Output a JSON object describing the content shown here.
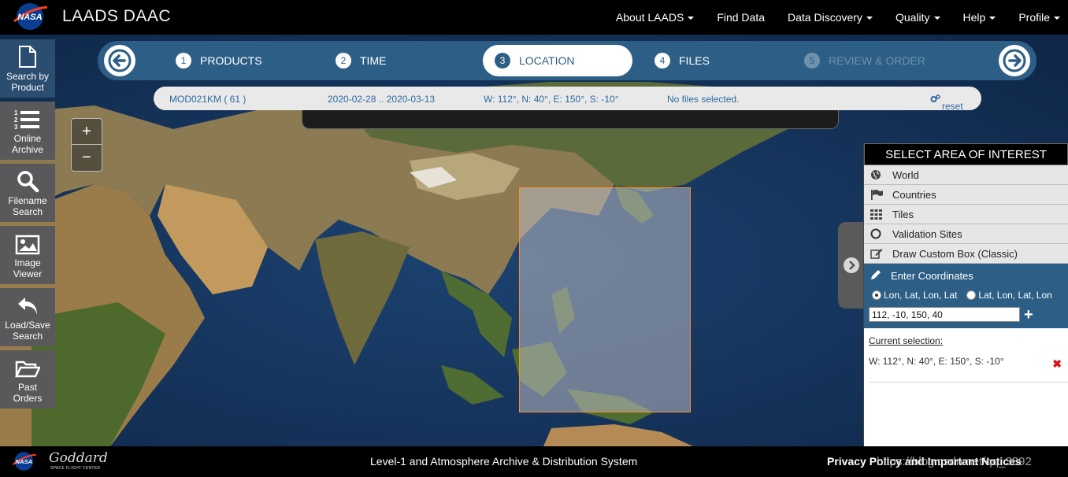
{
  "header": {
    "site_title": "LAADS DAAC",
    "nav": [
      {
        "label": "About LAADS",
        "dropdown": true
      },
      {
        "label": "Find Data",
        "dropdown": false
      },
      {
        "label": "Data Discovery",
        "dropdown": true
      },
      {
        "label": "Quality",
        "dropdown": true
      },
      {
        "label": "Help",
        "dropdown": true
      },
      {
        "label": "Profile",
        "dropdown": true
      }
    ]
  },
  "sidebar": {
    "items": [
      {
        "label": "Search by\nProduct",
        "icon": "document-icon",
        "active": false
      },
      {
        "label": "Online\nArchive",
        "icon": "numbered-list-icon",
        "active": false
      },
      {
        "label": "Filename\nSearch",
        "icon": "search-icon",
        "active": false
      },
      {
        "label": "Image\nViewer",
        "icon": "image-icon",
        "active": false
      },
      {
        "label": "Load/Save\nSearch",
        "icon": "undo-arrow-icon",
        "active": false
      },
      {
        "label": "Past\nOrders",
        "icon": "folder-open-icon",
        "active": false
      }
    ]
  },
  "wizard": {
    "steps": [
      {
        "num": "1",
        "label": "PRODUCTS",
        "state": "done"
      },
      {
        "num": "2",
        "label": "TIME",
        "state": "done"
      },
      {
        "num": "3",
        "label": "LOCATION",
        "state": "active"
      },
      {
        "num": "4",
        "label": "FILES",
        "state": "todo"
      },
      {
        "num": "5",
        "label": "REVIEW & ORDER",
        "state": "disabled"
      }
    ]
  },
  "summary": {
    "product": "MOD021KM ( 61 )",
    "dates": "2020-02-28 .. 2020-03-13",
    "bounds": "W: 112°, N: 40°, E: 150°, S: -10°",
    "files": "No files selected.",
    "reset": "reset"
  },
  "map": {
    "zoom_in": "+",
    "zoom_out": "−"
  },
  "aoi_panel": {
    "title": "SELECT AREA OF INTEREST",
    "options": [
      {
        "label": "World",
        "icon": "globe-icon"
      },
      {
        "label": "Countries",
        "icon": "flag-icon"
      },
      {
        "label": "Tiles",
        "icon": "grid-icon"
      },
      {
        "label": "Validation Sites",
        "icon": "circle-icon"
      },
      {
        "label": "Draw Custom Box (Classic)",
        "icon": "edit-box-icon"
      }
    ],
    "enter_coordinates": {
      "title": "Enter Coordinates",
      "radio_1": "Lon, Lat, Lon, Lat",
      "radio_2": "Lat, Lon, Lat, Lon",
      "selected_radio": 1,
      "input_value": "112, -10, 150, 40"
    },
    "current_selection_label": "Current selection:",
    "current_selection": "W: 112°, N: 40°, E: 150°, S: -10°"
  },
  "footer": {
    "center_text": "Level-1 and Atmosphere Archive & Distribution System",
    "privacy": "Privacy Policy and Important Notices",
    "watermark": "https://blog.csdn.net/qq_3392",
    "goddard": "Goddard",
    "goddard_sub": "SPACE FLIGHT CENTER"
  },
  "colors": {
    "wizard_bg": "#2d5f86",
    "selection_border": "#ff8a2a",
    "ocean": "#14305a"
  }
}
